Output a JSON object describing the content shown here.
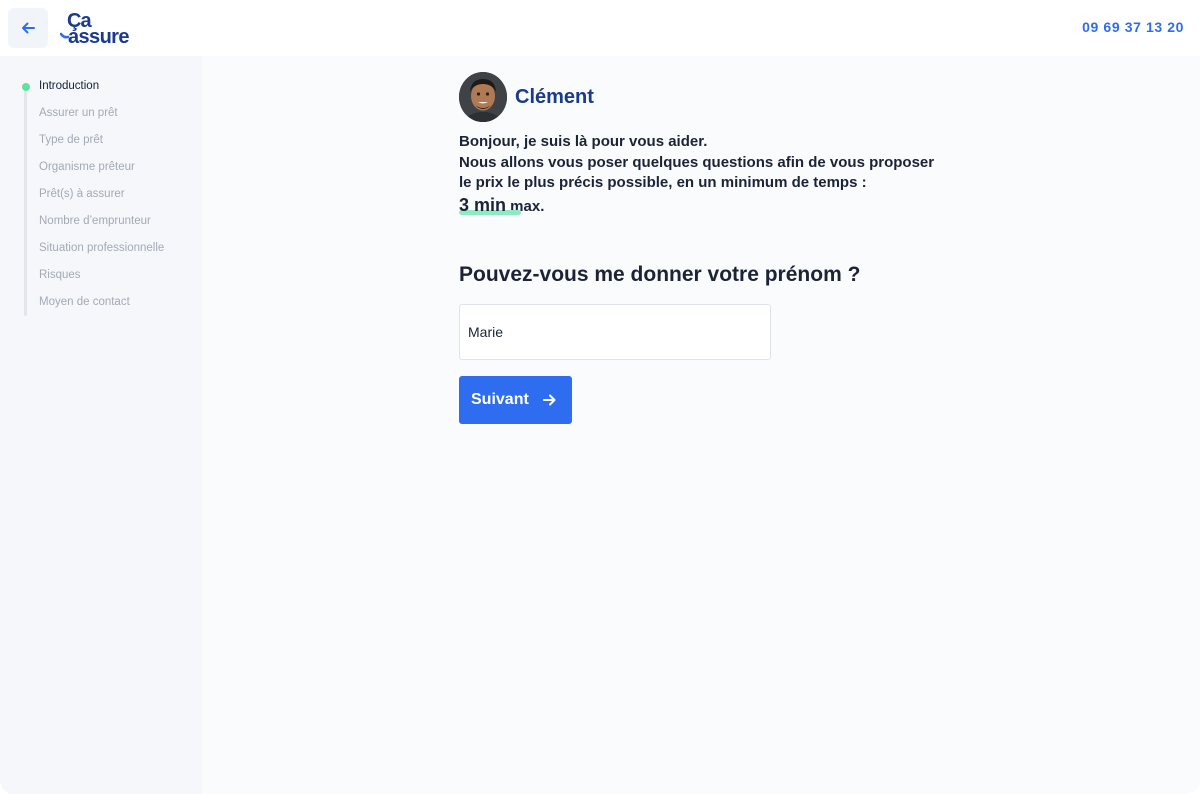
{
  "header": {
    "logo_top": "Ça",
    "logo_bottom": "assure",
    "phone": "09 69 37 13 20"
  },
  "sidebar": {
    "steps": [
      {
        "label": "Introduction",
        "active": true
      },
      {
        "label": "Assurer un prêt"
      },
      {
        "label": "Type de prêt"
      },
      {
        "label": "Organisme prêteur"
      },
      {
        "label": "Prêt(s) à assurer"
      },
      {
        "label": "Nombre d’emprunteur"
      },
      {
        "label": "Situation professionnelle"
      },
      {
        "label": "Risques"
      },
      {
        "label": "Moyen de contact"
      }
    ]
  },
  "main": {
    "agent_name": "Clément",
    "intro_line1": "Bonjour, je suis là pour vous aider.",
    "intro_line2": "Nous allons vous poser quelques questions afin de vous proposer",
    "intro_line3": "le prix le plus précis possible, en un minimum de temps :",
    "duration": "3 min",
    "duration_suffix": " max.",
    "question": "Pouvez-vous me donner votre prénom ?",
    "first_name_value": "Marie",
    "next_label": "Suivant"
  },
  "colors": {
    "accent": "#2f6df0",
    "brand": "#1a3a8c",
    "active_dot": "#5ee2a0",
    "highlight": "#8fe9c2"
  }
}
